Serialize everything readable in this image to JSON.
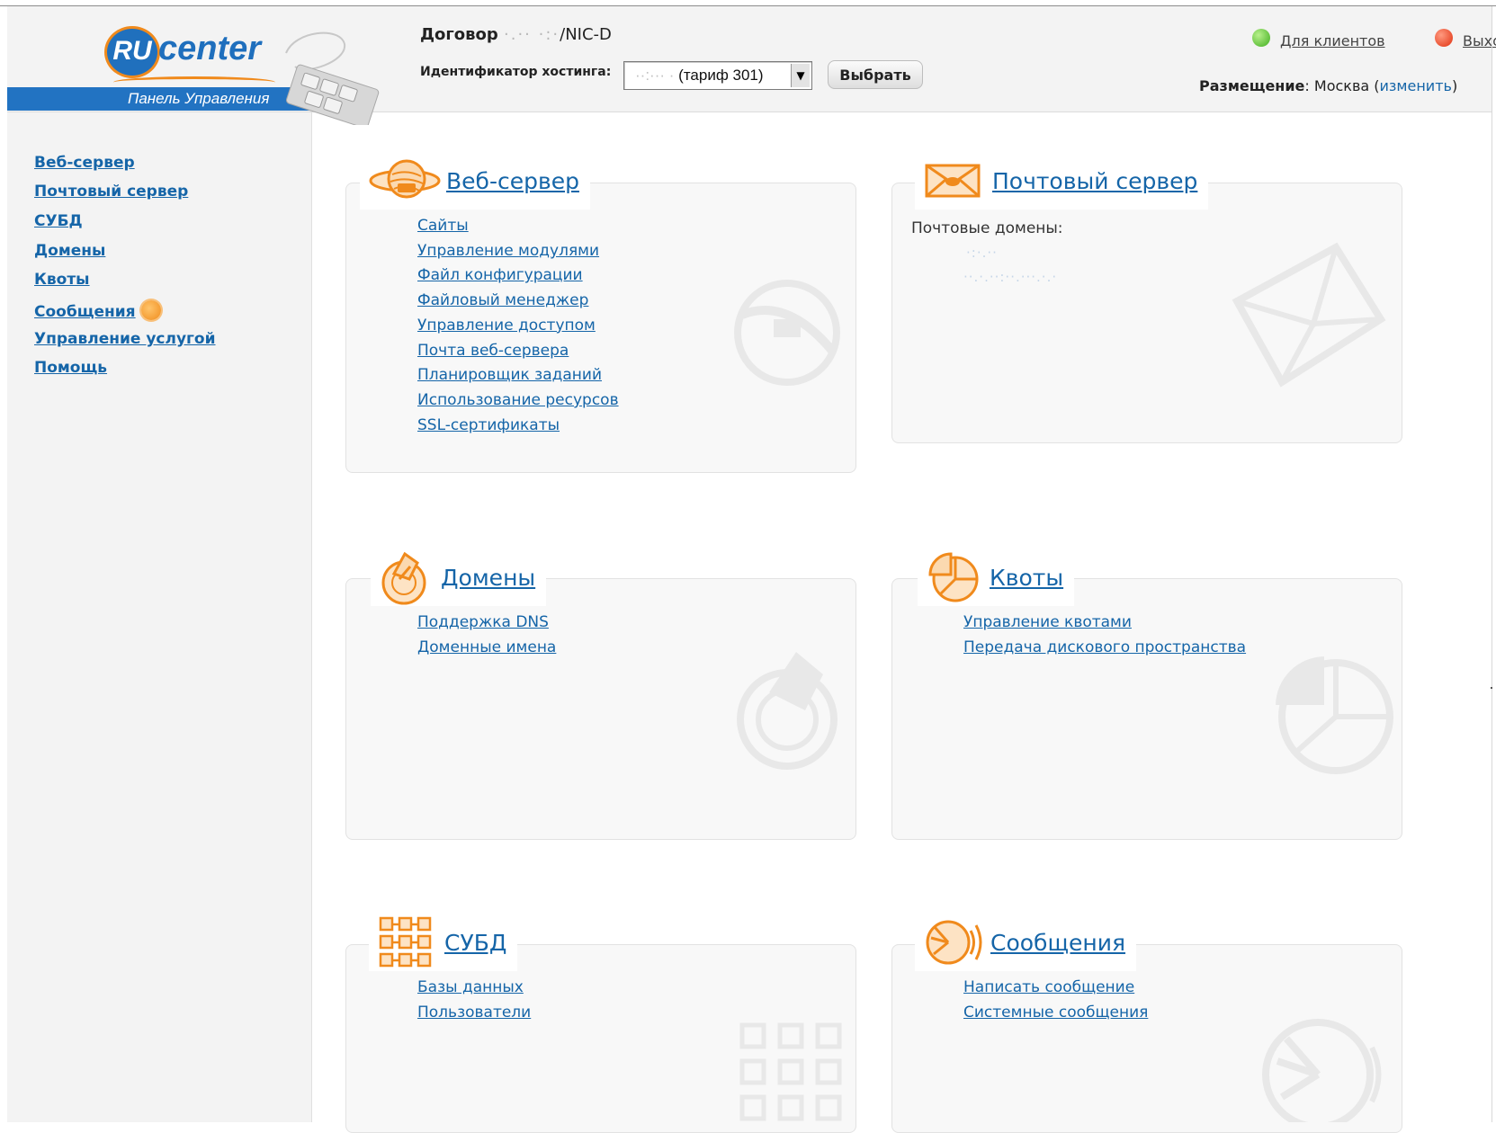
{
  "header": {
    "logo": {
      "ru": "RU",
      "center": "center",
      "subtitle": "Панель Управления"
    },
    "contract_label": "Договор",
    "contract_value_hidden": "·.·· ·:·",
    "contract_value": "/NIC-D",
    "hosting_label": "Идентификатор хостинга:",
    "hosting_select": {
      "value_hidden": "··:··· ·",
      "value": "(тариф 301)"
    },
    "select_button": "Выбрать",
    "for_clients": "Для клиентов",
    "logout": "Выход",
    "placement_label": "Размещение",
    "placement_value": "Москва",
    "placement_change": "изменить"
  },
  "sidebar": {
    "items": [
      {
        "label": "Веб-сервер"
      },
      {
        "label": "Почтовый сервер"
      },
      {
        "label": "СУБД"
      },
      {
        "label": "Домены"
      },
      {
        "label": "Квоты"
      },
      {
        "label": "Сообщения"
      },
      {
        "label": "Управление услугой"
      },
      {
        "label": "Помощь"
      }
    ]
  },
  "panels": {
    "web": {
      "title": "Веб-сервер",
      "icon": "web-server-icon",
      "links": [
        "Сайты",
        "Управление модулями",
        "Файл конфигурации",
        "Файловый менеджер",
        "Управление доступом",
        "Почта веб-сервера",
        "Планировщик заданий",
        "Использование ресурсов",
        "SSL-сертификаты"
      ]
    },
    "mail": {
      "title": "Почтовый сервер",
      "icon": "envelope-icon",
      "domains_label": "Почтовые домены:",
      "domains": [
        "·:·.··",
        "··.·.··:··.···.·.·"
      ]
    },
    "domains": {
      "title": "Домены",
      "icon": "domain-icon",
      "links": [
        "Поддержка DNS",
        "Доменные имена"
      ]
    },
    "quotas": {
      "title": "Квоты",
      "icon": "pie-chart-icon",
      "links": [
        "Управление квотами",
        "Передача дискового пространства"
      ]
    },
    "dbms": {
      "title": "СУБД",
      "icon": "database-grid-icon",
      "links": [
        "Базы данных",
        "Пользователи"
      ]
    },
    "messages": {
      "title": "Сообщения",
      "icon": "messages-icon",
      "links": [
        "Написать сообщение",
        "Системные сообщения"
      ]
    }
  },
  "colors": {
    "link": "#1565a8",
    "accent": "#f08a1c",
    "brand_blue": "#2273c2",
    "header_bg": "#f3f3f3"
  }
}
